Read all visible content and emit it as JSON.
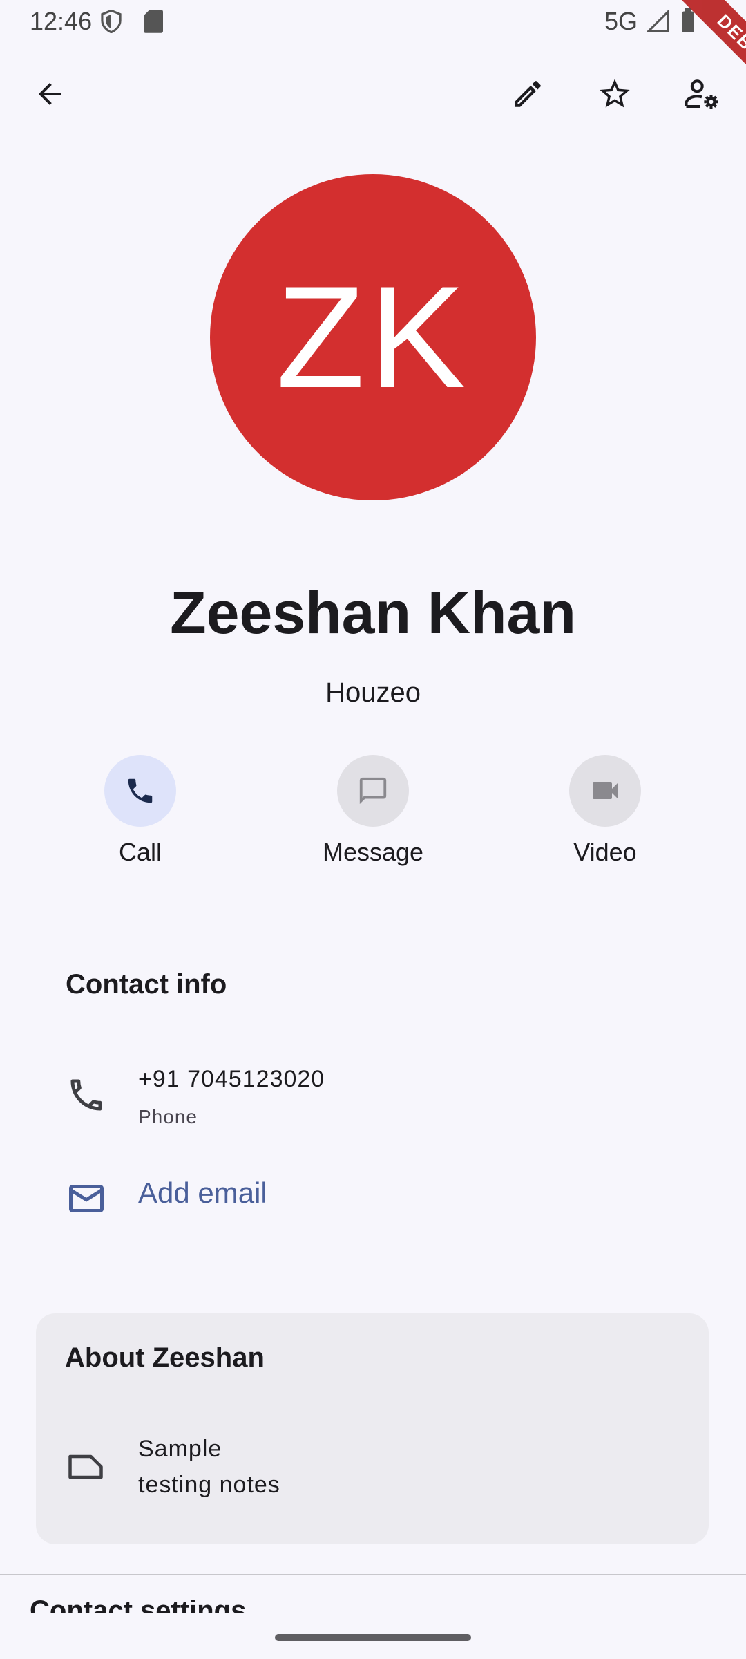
{
  "status_bar": {
    "time": "12:46",
    "network": "5G",
    "icons": [
      "shield-icon",
      "sd-card-icon",
      "signal-icon",
      "battery-icon"
    ]
  },
  "debug_banner": "DEBUG",
  "toolbar": {
    "icons": [
      "arrow-back-icon",
      "pencil-icon",
      "star-outline-icon",
      "person-settings-icon"
    ]
  },
  "contact": {
    "initials": "ZK",
    "avatar_color": "#d32f2f",
    "name": "Zeeshan Khan",
    "company": "Houzeo"
  },
  "actions": [
    {
      "label": "Call",
      "icon": "phone-icon",
      "enabled": true
    },
    {
      "label": "Message",
      "icon": "message-icon",
      "enabled": false
    },
    {
      "label": "Video",
      "icon": "videocam-icon",
      "enabled": false
    }
  ],
  "contact_info": {
    "title": "Contact info",
    "phone": {
      "number": "+91 7045123020",
      "type": "Phone"
    },
    "add_email": "Add email"
  },
  "about": {
    "title": "About Zeeshan",
    "notes": "Sample\ntesting notes"
  },
  "next_section_title": "Contact settings",
  "colors": {
    "accent": "#4a5f9a",
    "call_bg": "#dee3fa",
    "disabled_bg": "#e1e0e5",
    "background": "#f7f6fc",
    "card_bg": "#ecebf0"
  }
}
